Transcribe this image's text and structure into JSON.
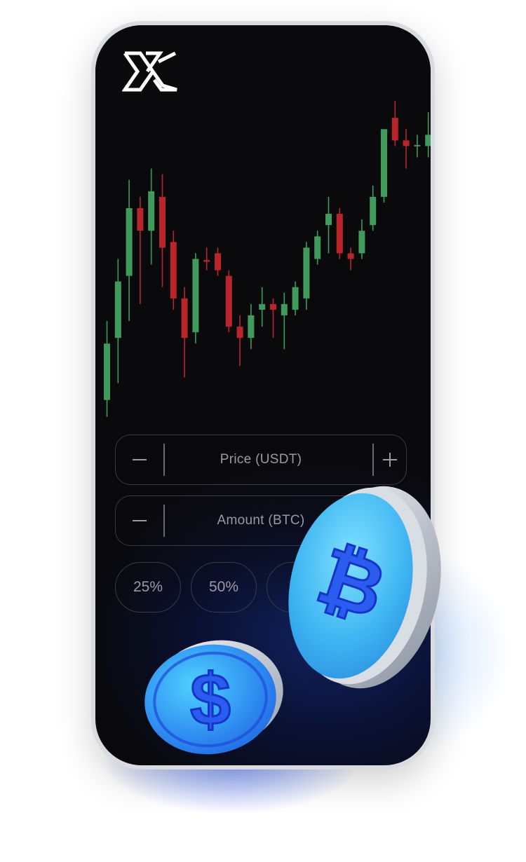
{
  "app": {
    "logo_icon": "x-brand-logo-icon"
  },
  "colors": {
    "bull": "#3f9a5c",
    "bear": "#b8262c",
    "accent": "#2a6bff"
  },
  "chart_data": {
    "type": "candlestick",
    "title": "",
    "candles": [
      {
        "open": 300,
        "close": 400,
        "high": 440,
        "low": 270
      },
      {
        "open": 410,
        "close": 510,
        "high": 550,
        "low": 330
      },
      {
        "open": 520,
        "close": 640,
        "high": 690,
        "low": 440
      },
      {
        "open": 640,
        "close": 600,
        "high": 660,
        "low": 470
      },
      {
        "open": 600,
        "close": 670,
        "high": 710,
        "low": 540
      },
      {
        "open": 660,
        "close": 570,
        "high": 700,
        "low": 500
      },
      {
        "open": 580,
        "close": 480,
        "high": 600,
        "low": 460
      },
      {
        "open": 480,
        "close": 410,
        "high": 500,
        "low": 340
      },
      {
        "open": 420,
        "close": 550,
        "high": 560,
        "low": 400
      },
      {
        "open": 548,
        "close": 545,
        "high": 570,
        "low": 530
      },
      {
        "open": 560,
        "close": 530,
        "high": 570,
        "low": 520
      },
      {
        "open": 520,
        "close": 430,
        "high": 530,
        "low": 420
      },
      {
        "open": 430,
        "close": 410,
        "high": 450,
        "low": 360
      },
      {
        "open": 410,
        "close": 450,
        "high": 470,
        "low": 390
      },
      {
        "open": 460,
        "close": 470,
        "high": 500,
        "low": 430
      },
      {
        "open": 470,
        "close": 460,
        "high": 480,
        "low": 410
      },
      {
        "open": 450,
        "close": 470,
        "high": 490,
        "low": 390
      },
      {
        "open": 460,
        "close": 500,
        "high": 510,
        "low": 450
      },
      {
        "open": 480,
        "close": 570,
        "high": 580,
        "low": 460
      },
      {
        "open": 550,
        "close": 590,
        "high": 600,
        "low": 540
      },
      {
        "open": 610,
        "close": 630,
        "high": 660,
        "low": 560
      },
      {
        "open": 630,
        "close": 560,
        "high": 640,
        "low": 550
      },
      {
        "open": 560,
        "close": 550,
        "high": 570,
        "low": 530
      },
      {
        "open": 560,
        "close": 600,
        "high": 620,
        "low": 550
      },
      {
        "open": 610,
        "close": 660,
        "high": 680,
        "low": 600
      },
      {
        "open": 660,
        "close": 780,
        "high": 780,
        "low": 650
      },
      {
        "open": 800,
        "close": 760,
        "high": 830,
        "low": 750
      },
      {
        "open": 760,
        "close": 750,
        "high": 780,
        "low": 710
      },
      {
        "open": 752,
        "close": 752,
        "high": 770,
        "low": 730
      },
      {
        "open": 750,
        "close": 770,
        "high": 810,
        "low": 730
      }
    ],
    "ylim": [
      250,
      840
    ],
    "grid": false
  },
  "form": {
    "price_placeholder": "Price (USDT)",
    "amount_placeholder": "Amount (BTC)",
    "percent_options": [
      "25%",
      "50%"
    ]
  },
  "decorations": {
    "coin_bitcoin_icon": "bitcoin-icon",
    "coin_dollar_icon": "dollar-icon"
  }
}
